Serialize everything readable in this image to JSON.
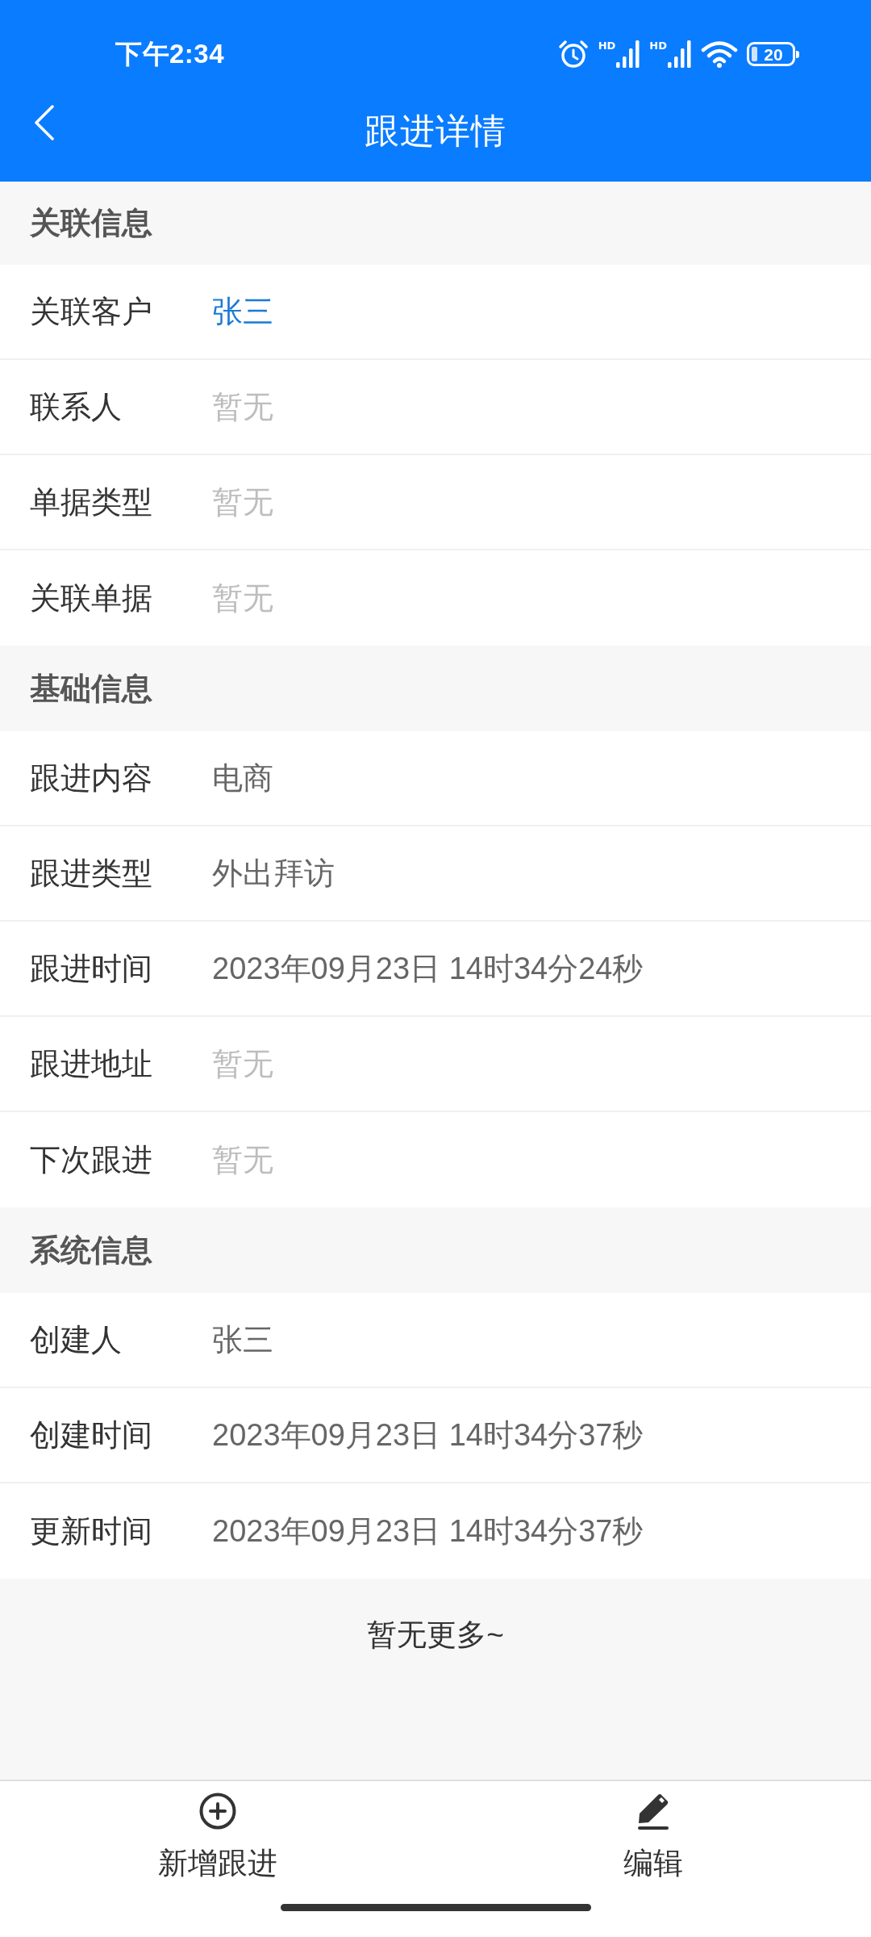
{
  "status_bar": {
    "time": "下午2:34",
    "networks": [
      {
        "label": "HD"
      },
      {
        "label": "HD"
      }
    ],
    "battery": "20"
  },
  "nav": {
    "title": "跟进详情"
  },
  "sections": [
    {
      "title": "关联信息",
      "rows": [
        {
          "label": "关联客户",
          "value": "张三",
          "kind": "link"
        },
        {
          "label": "联系人",
          "value": "暂无",
          "kind": "empty"
        },
        {
          "label": "单据类型",
          "value": "暂无",
          "kind": "empty"
        },
        {
          "label": "关联单据",
          "value": "暂无",
          "kind": "empty"
        }
      ]
    },
    {
      "title": "基础信息",
      "rows": [
        {
          "label": "跟进内容",
          "value": "电商",
          "kind": "text"
        },
        {
          "label": "跟进类型",
          "value": "外出拜访",
          "kind": "text"
        },
        {
          "label": "跟进时间",
          "value": "2023年09月23日 14时34分24秒",
          "kind": "text"
        },
        {
          "label": "跟进地址",
          "value": "暂无",
          "kind": "empty"
        },
        {
          "label": "下次跟进",
          "value": "暂无",
          "kind": "empty"
        }
      ]
    },
    {
      "title": "系统信息",
      "rows": [
        {
          "label": "创建人",
          "value": "张三",
          "kind": "text"
        },
        {
          "label": "创建时间",
          "value": "2023年09月23日 14时34分37秒",
          "kind": "text"
        },
        {
          "label": "更新时间",
          "value": "2023年09月23日 14时34分37秒",
          "kind": "text"
        }
      ]
    }
  ],
  "footer": "暂无更多~",
  "actions": [
    {
      "label": "新增跟进",
      "kind": "add"
    },
    {
      "label": "编辑",
      "kind": "edit"
    }
  ]
}
